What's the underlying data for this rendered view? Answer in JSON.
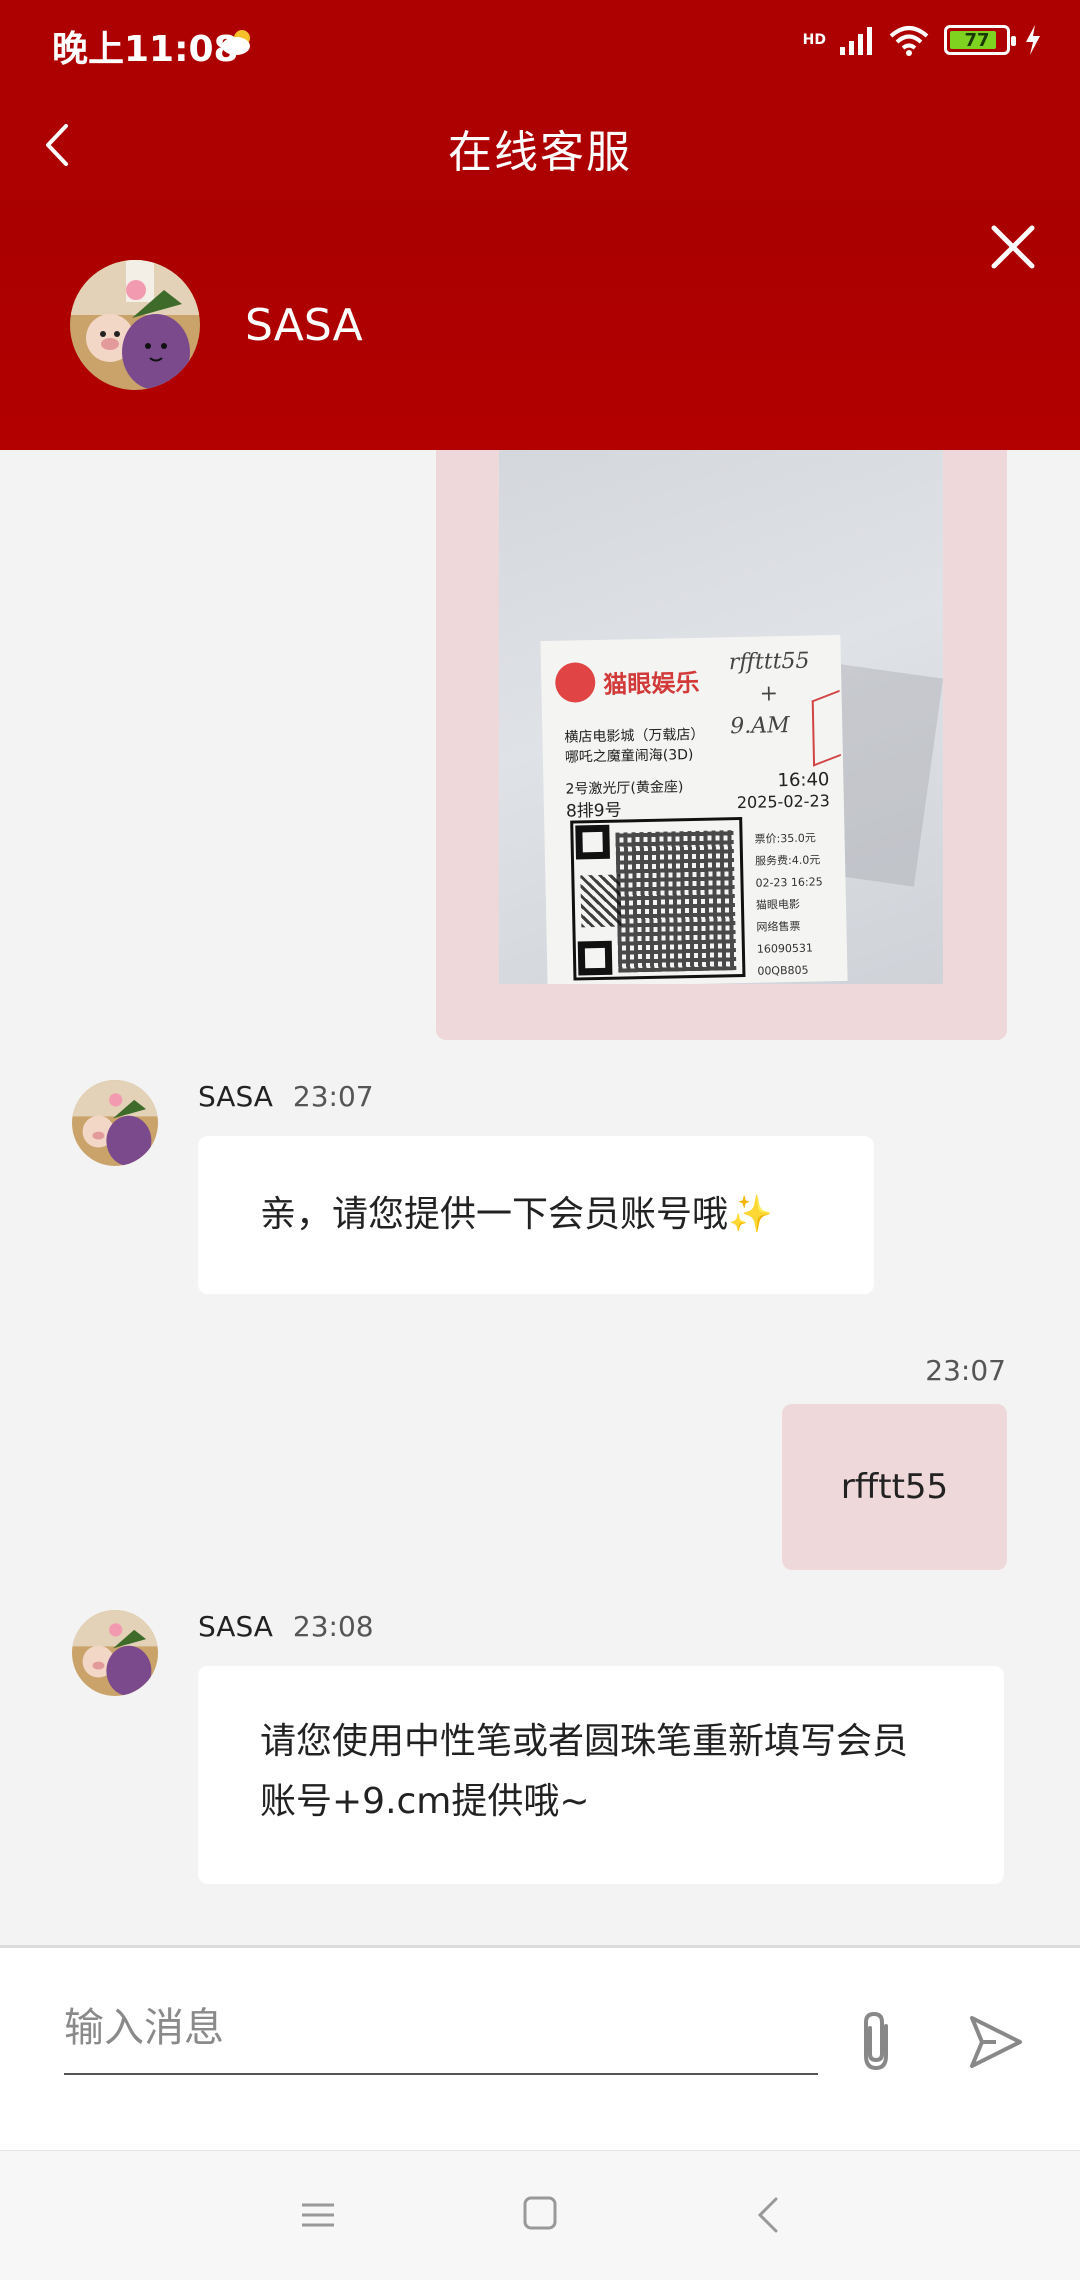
{
  "status_bar": {
    "time": "晚上11:08",
    "network_label": "HD",
    "battery_level": "77"
  },
  "header": {
    "title": "在线客服"
  },
  "agent": {
    "name": "SASA"
  },
  "ticket_photo": {
    "brand": "猫眼娱乐",
    "handwriting": [
      "rffttt55",
      "+",
      "9.AM"
    ],
    "cinema": "横店电影城（万载店）",
    "movie": "哪吒之魔童闹海(3D)",
    "hall": "2号激光厅(黄金座)",
    "seat": "8排9号",
    "showtime": "16:40",
    "date": "2025-02-23",
    "side_info": [
      "票价:35.0元",
      "服务费:4.0元",
      "02-23 16:25",
      "猫眼电影",
      "网络售票",
      "16090531",
      "00QB805"
    ]
  },
  "messages": [
    {
      "id": "m1",
      "sender": "SASA",
      "time": "23:07",
      "text": "亲，请您提供一下会员账号哦✨"
    },
    {
      "id": "m2",
      "time": "23:07",
      "text": "rfftt55"
    },
    {
      "id": "m3",
      "sender": "SASA",
      "time": "23:08",
      "text": "请您使用中性笔或者圆珠笔重新填写会员账号+9.cm提供哦~"
    }
  ],
  "composer": {
    "placeholder": "输入消息"
  },
  "colors": {
    "brand_red": "#ad0000",
    "outgoing_bubble": "#efd8d9",
    "incoming_bubble": "#ffffff",
    "chat_bg": "#f3f3f3"
  },
  "icons": {
    "back": "chevron-left-icon",
    "close": "close-icon",
    "attach": "paperclip-icon",
    "send": "send-icon",
    "sys_menu": "menu-icon",
    "sys_home": "home-square-icon",
    "sys_back": "chevron-left-icon"
  }
}
